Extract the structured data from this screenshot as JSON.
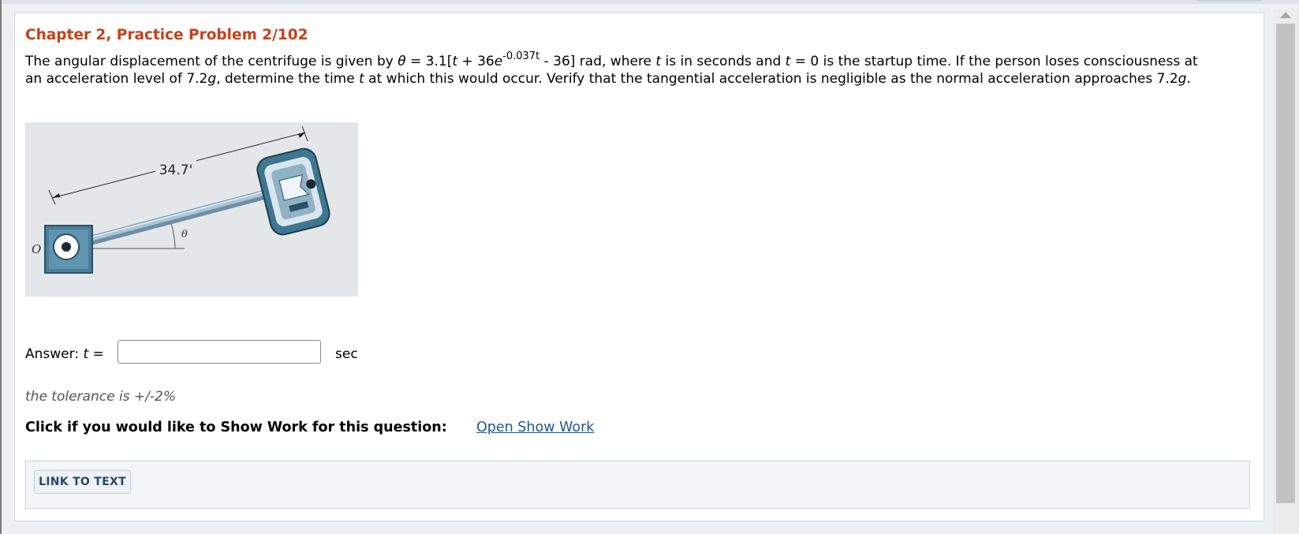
{
  "problem": {
    "title": "Chapter 2, Practice Problem 2/102",
    "q_part1": "The angular displacement of the centrifuge is given by ",
    "theta_symbol": "θ",
    "q_part2": " = 3.1[",
    "t1": "t",
    "q_part3": " + 36",
    "e_symbol": "e",
    "exponent": "-0.037t",
    "q_part4": " - 36] rad, where ",
    "t2": "t",
    "q_part5": " is in seconds and ",
    "t3": "t",
    "q_part6": " = 0 is the startup time. If the person loses consciousness at an acceleration level of 7.2",
    "g1": "g",
    "q_part7": ", determine the time ",
    "t4": "t",
    "q_part8": " at which this would occur. Verify that the tangential acceleration is negligible as the normal acceleration approaches 7.2",
    "g2": "g",
    "q_part9": "."
  },
  "figure": {
    "dimension_label": "34.7'",
    "origin_label": "O",
    "angle_label": "θ"
  },
  "answer": {
    "label": "Answer: ",
    "var": "t",
    "equals": " =",
    "value": "",
    "placeholder": "",
    "unit": "sec"
  },
  "tolerance": "the tolerance is +/-2%",
  "show_work": {
    "label": "Click if you would like to Show Work for this question:",
    "link": "Open Show Work"
  },
  "link_to_text": "LINK TO TEXT"
}
